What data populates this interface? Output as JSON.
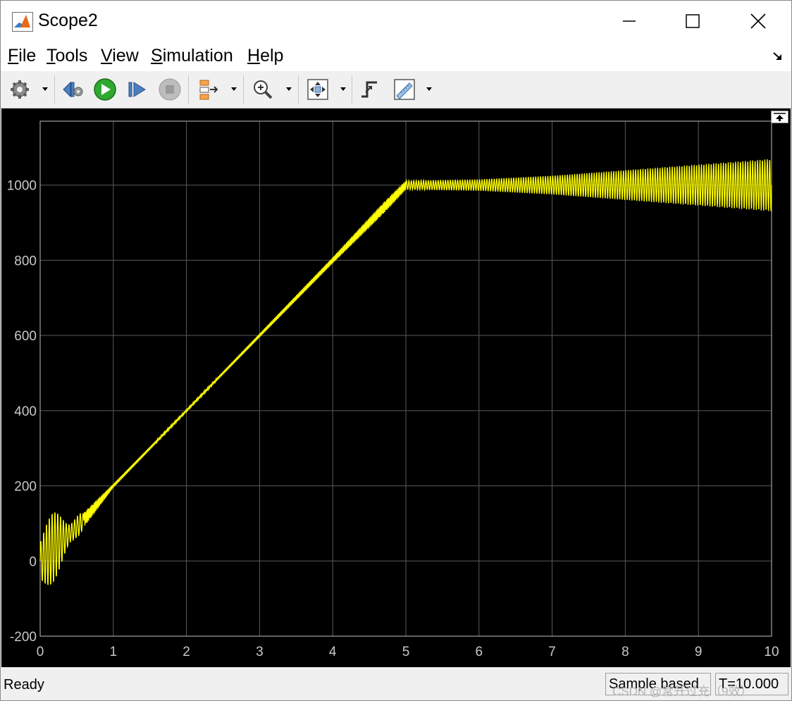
{
  "window": {
    "title": "Scope2"
  },
  "menu": [
    {
      "accel": "F",
      "rest": "ile"
    },
    {
      "accel": "T",
      "rest": "ools"
    },
    {
      "accel": "V",
      "rest": "iew"
    },
    {
      "accel": "S",
      "rest": "imulation"
    },
    {
      "accel": "H",
      "rest": "elp"
    }
  ],
  "toolbar": {
    "icons": [
      "settings-gear-icon",
      "step-back-icon",
      "run-icon",
      "step-forward-icon",
      "stop-icon",
      "highlight-simulink-block-icon",
      "zoom-in-icon",
      "fit-to-view-icon",
      "signal-triggers-icon",
      "measurements-ruler-icon"
    ],
    "run_color": "#27a327"
  },
  "status": {
    "ready": "Ready",
    "sample_mode": "Sample based",
    "time": "T=10.000",
    "watermark": "CSDN @常开过充（9效）"
  },
  "chart_data": {
    "type": "line",
    "background": "#000000",
    "line_color": "#ffff00",
    "grid": true,
    "xlim": [
      0,
      10
    ],
    "ylim": [
      -200,
      1170
    ],
    "xticks": [
      0,
      1,
      2,
      3,
      4,
      5,
      6,
      7,
      8,
      9,
      10
    ],
    "yticks": [
      -200,
      0,
      200,
      400,
      600,
      800,
      1000
    ],
    "xticklabels": [
      "0",
      "1",
      "2",
      "3",
      "4",
      "5",
      "6",
      "7",
      "8",
      "9",
      "10"
    ],
    "yticklabels": [
      "-200",
      "0",
      "200",
      "400",
      "600",
      "800",
      "1000"
    ],
    "title": "",
    "xlabel": "",
    "ylabel": "",
    "series": [
      {
        "x": [
          0,
          0.2,
          0.45,
          0.6,
          1.0,
          2.0,
          3.0,
          4.0,
          4.7,
          5.0,
          6.0,
          7.0,
          8.0,
          9.0,
          10.0
        ],
        "y": [
          0,
          40,
          80,
          110,
          200,
          400,
          600,
          800,
          940,
          1000,
          1000,
          1000,
          1000,
          1000,
          1000
        ],
        "oscillation_amplitude": [
          80,
          100,
          120,
          20,
          5,
          3,
          5,
          8,
          15,
          12,
          15,
          25,
          40,
          55,
          70
        ]
      }
    ]
  }
}
